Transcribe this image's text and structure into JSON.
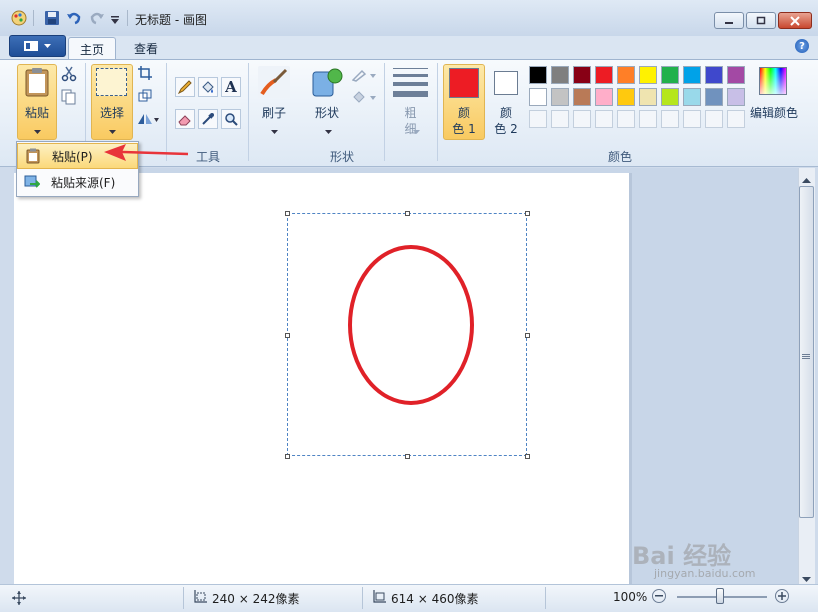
{
  "window": {
    "title": "无标题 - 画图"
  },
  "tabs": [
    {
      "label": "主页"
    },
    {
      "label": "查看"
    }
  ],
  "ribbon": {
    "clipboard": {
      "paste_label": "粘贴"
    },
    "image": {
      "select_label": "选择"
    },
    "tools": {
      "group_label": "工具"
    },
    "brushes": {
      "label": "刷子"
    },
    "shapes": {
      "label": "形状",
      "group_label": "形状"
    },
    "size": {
      "line1": "粗",
      "line2": "细"
    },
    "colors": {
      "color1_line1": "颜",
      "color1_line2": "色 1",
      "color2_line1": "颜",
      "color2_line2": "色 2",
      "edit_label": "编辑颜色",
      "group_label": "颜色",
      "color1": "#ed1c24",
      "color2": "#ffffff",
      "palette_row1": [
        "#000000",
        "#7f7f7f",
        "#880015",
        "#ed1c24",
        "#ff7f27",
        "#fff200",
        "#22b14c",
        "#00a2e8",
        "#3f48cc",
        "#a349a4"
      ],
      "palette_row2": [
        "#ffffff",
        "#c3c3c3",
        "#b97a57",
        "#ffaec9",
        "#ffc90e",
        "#efe4b0",
        "#b5e61d",
        "#99d9ea",
        "#7092be",
        "#c8bfe7"
      ]
    }
  },
  "paste_menu": {
    "items": [
      {
        "label": "粘贴(P)",
        "icon": "clipboard-icon"
      },
      {
        "label": "粘贴来源(F)",
        "icon": "paste-from-icon"
      }
    ]
  },
  "canvas": {
    "shape": "ellipse",
    "stroke_color": "#e02128"
  },
  "status": {
    "selection_size": "240 × 242像素",
    "image_size": "614 × 460像素",
    "zoom": "100%"
  },
  "watermark": {
    "text": "Bai 经验",
    "subtext": "jingyan.baidu.com"
  }
}
